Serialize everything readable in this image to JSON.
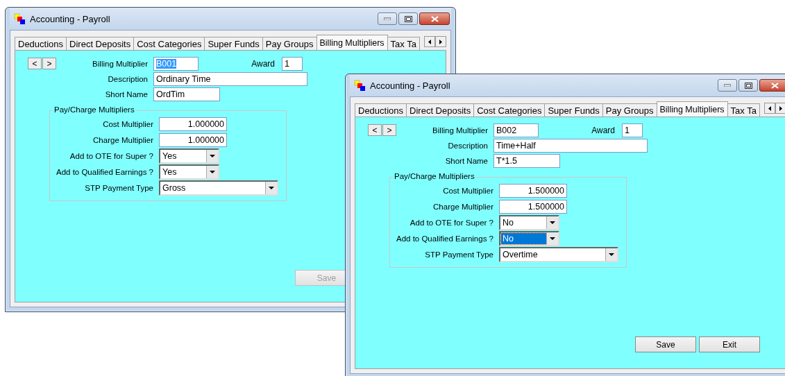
{
  "windows": [
    {
      "title": "Accounting - Payroll",
      "tabs": [
        {
          "label": "Deductions",
          "selected": false
        },
        {
          "label": "Direct Deposits",
          "selected": false
        },
        {
          "label": "Cost Categories",
          "selected": false
        },
        {
          "label": "Super Funds",
          "selected": false
        },
        {
          "label": "Pay Groups",
          "selected": false
        },
        {
          "label": "Billing Multipliers",
          "selected": true
        },
        {
          "label": "Tax Ta",
          "selected": false
        }
      ],
      "nav": [
        "<",
        ">"
      ],
      "billing_multiplier": {
        "label": "Billing Multiplier",
        "value": "B001",
        "highlighted": true
      },
      "award": {
        "label": "Award",
        "value": "1",
        "highlighted": false
      },
      "description": {
        "label": "Description",
        "value": "Ordinary Time",
        "highlighted": false
      },
      "short_name": {
        "label": "Short Name",
        "value": "OrdTim",
        "highlighted": false
      },
      "group": {
        "title": "Pay/Charge Multipliers",
        "fields": [
          {
            "label": "Cost Multiplier",
            "value": "1.000000",
            "kind": "number",
            "highlighted": false
          },
          {
            "label": "Charge Multiplier",
            "value": "1.000000",
            "kind": "number",
            "highlighted": false
          },
          {
            "label": "Add to OTE for Super ?",
            "value": "Yes",
            "kind": "combo",
            "highlighted": false
          },
          {
            "label": "Add to Qualified Earnings ?",
            "value": "Yes",
            "kind": "combo",
            "highlighted": false
          },
          {
            "label": "STP Payment Type",
            "value": "Gross",
            "kind": "wide",
            "highlighted": false
          }
        ]
      },
      "buttons": [
        {
          "label": "Save",
          "disabled": true
        }
      ]
    },
    {
      "title": "Accounting - Payroll",
      "tabs": [
        {
          "label": "Deductions",
          "selected": false
        },
        {
          "label": "Direct Deposits",
          "selected": false
        },
        {
          "label": "Cost Categories",
          "selected": false
        },
        {
          "label": "Super Funds",
          "selected": false
        },
        {
          "label": "Pay Groups",
          "selected": false
        },
        {
          "label": "Billing Multipliers",
          "selected": true
        },
        {
          "label": "Tax Ta",
          "selected": false
        }
      ],
      "nav": [
        "<",
        ">"
      ],
      "billing_multiplier": {
        "label": "Billing Multiplier",
        "value": "B002",
        "highlighted": false
      },
      "award": {
        "label": "Award",
        "value": "1",
        "highlighted": false
      },
      "description": {
        "label": "Description",
        "value": "Time+Half",
        "highlighted": false
      },
      "short_name": {
        "label": "Short Name",
        "value": "T*1.5",
        "highlighted": false
      },
      "group": {
        "title": "Pay/Charge Multipliers",
        "fields": [
          {
            "label": "Cost Multiplier",
            "value": "1.500000",
            "kind": "number",
            "highlighted": false
          },
          {
            "label": "Charge Multiplier",
            "value": "1.500000",
            "kind": "number",
            "highlighted": false
          },
          {
            "label": "Add to OTE for Super ?",
            "value": "No",
            "kind": "combo",
            "highlighted": false
          },
          {
            "label": "Add to Qualified Earnings ?",
            "value": "No",
            "kind": "combo",
            "highlighted": true
          },
          {
            "label": "STP Payment Type",
            "value": "Overtime",
            "kind": "wide",
            "highlighted": false
          }
        ]
      },
      "buttons": [
        {
          "label": "Save",
          "disabled": false
        },
        {
          "label": "Exit",
          "disabled": false
        }
      ]
    }
  ]
}
